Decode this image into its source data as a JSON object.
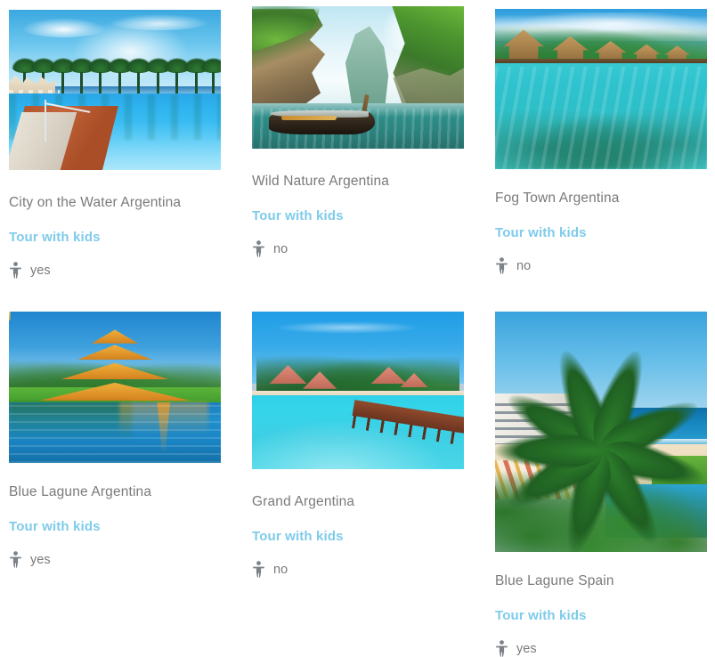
{
  "page": {
    "background_color": "#ffffff",
    "title_color": "#7a7a7a",
    "accent_color": "#7ecbeb",
    "meta_label": "Tour with kids",
    "kid_icon_name": "child-icon"
  },
  "cards": [
    {
      "id": "city-on-the-water-argentina",
      "title": "City on the Water Argentina",
      "sub_label": "Tour with kids",
      "kids_value": "yes",
      "photo_alt": "Resort swimming pool with palm trees at the waterfront"
    },
    {
      "id": "wild-nature-argentina",
      "title": "Wild Nature Argentina",
      "sub_label": "Tour with kids",
      "kids_value": "no",
      "photo_alt": "Longtail boat between jungle limestone cliffs"
    },
    {
      "id": "fog-town-argentina",
      "title": "Fog Town Argentina",
      "sub_label": "Tour with kids",
      "kids_value": "no",
      "photo_alt": "Overwater thatched bungalows above a turquoise lagoon"
    },
    {
      "id": "blue-lagune-argentina",
      "title": "Blue Lagune Argentina",
      "sub_label": "Tour with kids",
      "kids_value": "yes",
      "photo_alt": "Golden temple reflected in a calm lake"
    },
    {
      "id": "grand-argentina",
      "title": "Grand Argentina",
      "sub_label": "Tour with kids",
      "kids_value": "no",
      "photo_alt": "Tropical island with wooden jetty over turquoise sea"
    },
    {
      "id": "blue-lagune-spain",
      "title": "Blue Lagune Spain",
      "sub_label": "Tour with kids",
      "kids_value": "yes",
      "photo_alt": "Beachfront hotel with palm trees and parasols"
    }
  ]
}
